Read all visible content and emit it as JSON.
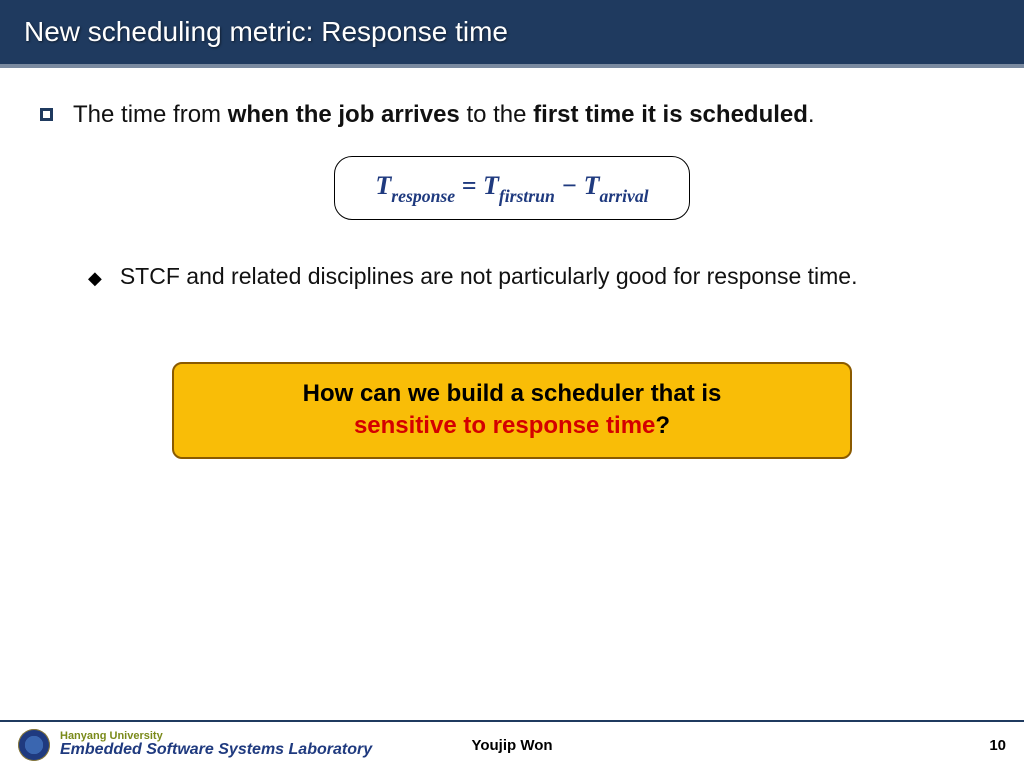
{
  "title": "New scheduling metric: Response time",
  "bullet1": {
    "pre": "The time from ",
    "b1": "when the job arrives",
    "mid": " to the ",
    "b2": "first time it is scheduled",
    "post": "."
  },
  "formula": {
    "T": "T",
    "sub_response": "response",
    "eq": " = ",
    "sub_firstrun": "firstrun",
    "minus": " − ",
    "sub_arrival": "arrival"
  },
  "bullet2": "STCF and related disciplines are not particularly good for response time.",
  "callout": {
    "line1": "How can we build a scheduler that is",
    "em": "sensitive to response time",
    "q": "?"
  },
  "footer": {
    "university": "Hanyang University",
    "lab": "Embedded Software Systems Laboratory",
    "author": "Youjip Won",
    "page": "10"
  }
}
